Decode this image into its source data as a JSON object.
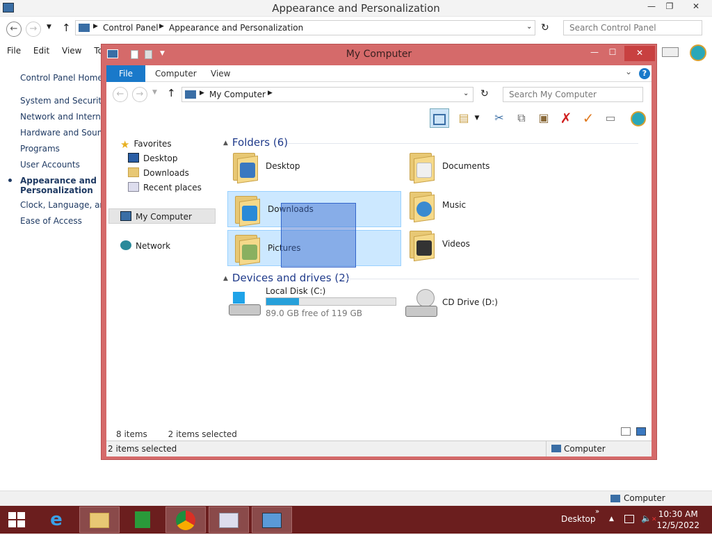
{
  "background_window": {
    "title": "Appearance and Personalization",
    "breadcrumb": [
      "Control Panel",
      "Appearance and Personalization"
    ],
    "search_placeholder": "Search Control Panel",
    "menu": [
      "File",
      "Edit",
      "View",
      "Tool"
    ],
    "side_links": [
      "Control Panel Home",
      "System and Security",
      "Network and Internet",
      "Hardware and Sound",
      "Programs",
      "User Accounts",
      "Appearance and Personalization",
      "Clock, Language, and",
      "Ease of Access"
    ],
    "active_link_index": 6,
    "status_right": "Computer"
  },
  "explorer": {
    "title": "My Computer",
    "ribbon_tabs": [
      "File",
      "Computer",
      "View"
    ],
    "address": "My Computer",
    "search_placeholder": "Search My Computer",
    "nav": {
      "favorites": "Favorites",
      "favorite_items": [
        "Desktop",
        "Downloads",
        "Recent places"
      ],
      "computer": "My Computer",
      "network": "Network"
    },
    "folders_heading": "Folders (6)",
    "folders": [
      {
        "name": "Desktop",
        "selected": false
      },
      {
        "name": "Documents",
        "selected": false
      },
      {
        "name": "Downloads",
        "selected": true
      },
      {
        "name": "Music",
        "selected": false
      },
      {
        "name": "Pictures",
        "selected": true
      },
      {
        "name": "Videos",
        "selected": false
      }
    ],
    "drives_heading": "Devices and drives (2)",
    "drives": [
      {
        "name": "Local Disk (C:)",
        "free_text": "89.0 GB free of 119 GB",
        "used_fraction": 0.25
      },
      {
        "name": "CD Drive (D:)"
      }
    ],
    "status_items": "8 items",
    "status_selected": "2 items selected",
    "statusbar_left": "2 items selected",
    "statusbar_right": "Computer"
  },
  "taskbar": {
    "desktop_label": "Desktop",
    "time": "10:30 AM",
    "date": "12/5/2022",
    "accent": "#6b1e1e"
  }
}
